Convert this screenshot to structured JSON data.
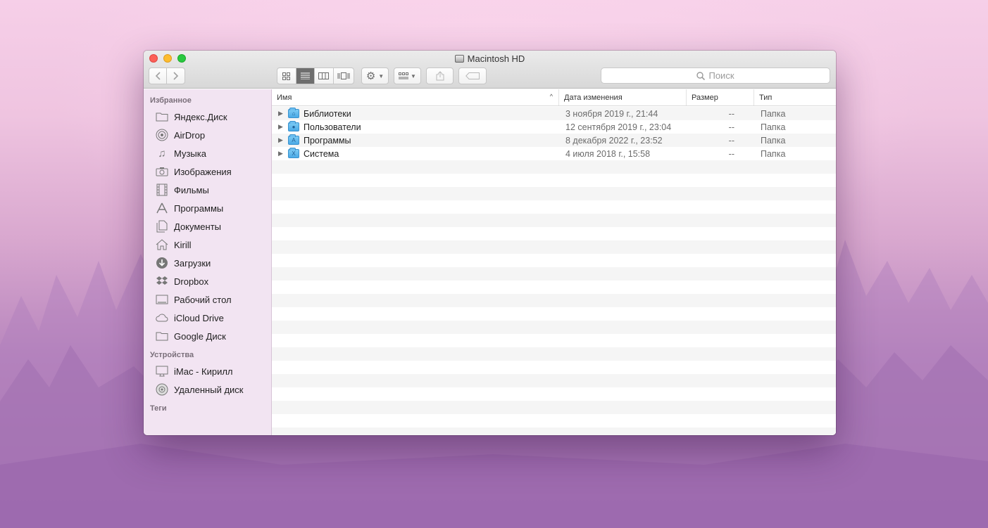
{
  "window": {
    "title": "Macintosh HD"
  },
  "search": {
    "placeholder": "Поиск"
  },
  "sidebar": {
    "sections": [
      {
        "title": "Избранное"
      },
      {
        "title": "Устройства"
      },
      {
        "title": "Теги"
      }
    ],
    "favorites": [
      {
        "label": "Яндекс.Диск",
        "icon": "folder-icon"
      },
      {
        "label": "AirDrop",
        "icon": "airdrop-icon"
      },
      {
        "label": "Музыка",
        "icon": "music-icon"
      },
      {
        "label": "Изображения",
        "icon": "camera-icon"
      },
      {
        "label": "Фильмы",
        "icon": "film-icon"
      },
      {
        "label": "Программы",
        "icon": "apps-icon"
      },
      {
        "label": "Документы",
        "icon": "documents-icon"
      },
      {
        "label": "Kirill",
        "icon": "home-icon"
      },
      {
        "label": "Загрузки",
        "icon": "download-icon"
      },
      {
        "label": "Dropbox",
        "icon": "dropbox-icon"
      },
      {
        "label": "Рабочий стол",
        "icon": "desktop-icon"
      },
      {
        "label": "iCloud Drive",
        "icon": "cloud-icon"
      },
      {
        "label": "Google Диск",
        "icon": "folder-icon"
      }
    ],
    "devices": [
      {
        "label": "iMac - Кирилл",
        "icon": "imac-icon"
      },
      {
        "label": "Удаленный диск",
        "icon": "disc-icon"
      }
    ]
  },
  "columns": {
    "name": "Имя",
    "date": "Дата изменения",
    "size": "Размер",
    "kind": "Тип"
  },
  "rows": [
    {
      "name": "Библиотеки",
      "date": "3 ноября 2019 г., 21:44",
      "size": "--",
      "kind": "Папка",
      "badge": "⌂"
    },
    {
      "name": "Пользователи",
      "date": "12 сентября 2019 г., 23:04",
      "size": "--",
      "kind": "Папка",
      "badge": "●"
    },
    {
      "name": "Программы",
      "date": "8 декабря 2022 г., 23:52",
      "size": "--",
      "kind": "Папка",
      "badge": "A"
    },
    {
      "name": "Система",
      "date": "4 июля 2018 г., 15:58",
      "size": "--",
      "kind": "Папка",
      "badge": "X"
    }
  ]
}
